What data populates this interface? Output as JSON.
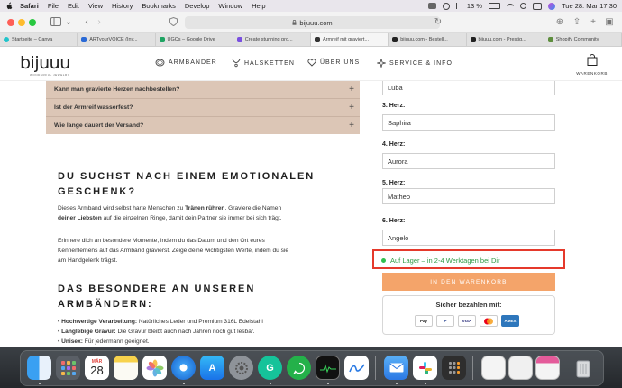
{
  "menubar": {
    "app": "Safari",
    "items": [
      "File",
      "Edit",
      "View",
      "History",
      "Bookmarks",
      "Develop",
      "Window",
      "Help"
    ],
    "battery": "13 %",
    "datetime": "Tue 28. Mar  17:30"
  },
  "toolbar": {
    "url": "bijuuu.com"
  },
  "tabs": [
    {
      "label": "Startseite – Canva",
      "color": "#20c4cb"
    },
    {
      "label": "ARTyourVOICE (Inv...",
      "color": "#2a6ad6"
    },
    {
      "label": "UGCs – Google Drive",
      "color": "#1fa463"
    },
    {
      "label": "Create stunning pro...",
      "color": "#7a4fe0"
    },
    {
      "label": "Armreif mit graviert...",
      "color": "#333333"
    },
    {
      "label": "bijuuu.com - Bestell...",
      "color": "#222222"
    },
    {
      "label": "bijuuu.com - Prestig...",
      "color": "#222222"
    },
    {
      "label": "Shopify Community",
      "color": "#5e8e3e"
    }
  ],
  "header": {
    "logo": "bijuuu",
    "logo_sub": "WONDERFUL JEWELRY",
    "nav": [
      "ARMBÄNDER",
      "HALSKETTEN",
      "ÜBER UNS",
      "SERVICE & INFO"
    ],
    "cart_label": "WARENKORB"
  },
  "faq": [
    "Kann man gravierte Herzen nachbestellen?",
    "Ist der Armreif wasserfest?",
    "Wie lange dauert der Versand?"
  ],
  "section1": {
    "heading_line1": "DU SUCHST NACH EINEM EMOTIONALEN",
    "heading_line2": "GESCHENK?",
    "p1_a": "Dieses Armband wird selbst harte Menschen zu ",
    "p1_b": "Tränen rühren",
    "p1_c": ". Graviere die Namen",
    "p1_d": "deiner Liebsten",
    "p1_e": " auf die einzelnen Ringe, damit dein Partner sie immer bei sich trägt.",
    "p2_l1": "Erinnere dich an besondere Momente, indem du das Datum und den Ort eures",
    "p2_l2": "Kennenlernens auf das Armband gravierst. Zeige deine wichtigsten Werte, indem du sie",
    "p2_l3": "am Handgelenk trägst."
  },
  "section2": {
    "heading_line1": "DAS BESONDERE AN UNSEREN",
    "heading_line2": "ARMBÄNDERN:",
    "bullets": [
      {
        "bold": "Hochwertige Verarbeitung:",
        "text": " Natürliches Leder und Premium 316L Edelstahl"
      },
      {
        "bold": "Langlebige Gravur:",
        "text": " Die Gravur bleibt auch nach Jahren noch gut lesbar."
      },
      {
        "bold": "Unisex:",
        "text": " Für jedermann geeignet."
      }
    ]
  },
  "form": {
    "field1_value": "Luba",
    "fields": [
      {
        "label": "3. Herz:",
        "value": "Saphira"
      },
      {
        "label": "4. Herz:",
        "value": "Aurora"
      },
      {
        "label": "5. Herz:",
        "value": "Matheo"
      },
      {
        "label": "6. Herz:",
        "value": "Angelo"
      }
    ],
    "stock": "Auf Lager – in 2-4 Werktagen bei Dir",
    "cta": "IN DEN WARENKORB",
    "pay_title": "Sicher bezahlen mit:",
    "pay_methods": [
      "Apple Pay",
      "PayPal",
      "VISA",
      "MC",
      "AMEX"
    ]
  },
  "dock": {
    "calendar_month": "MÄR",
    "calendar_day": "28"
  }
}
